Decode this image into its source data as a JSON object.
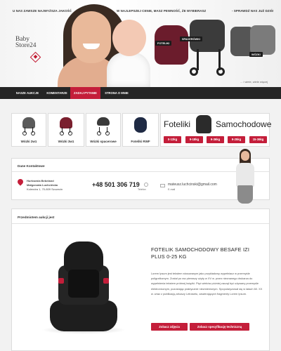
{
  "header": {
    "taglines": [
      "U NAS ZAWSZE NAJWYŻSZA JAKOŚĆ",
      "W NAJLEPSZEJ CENIE, MASZ PEWNOŚĆ, ŻE WYBIERASZ",
      "- SPRAWDŹ NAS JUŻ DZIŚ!"
    ],
    "logo_line1": "Baby",
    "logo_line2": "Store24",
    "badges": {
      "fotelik": "FOTELIKI",
      "spacerowki": "SPACERÓWKI",
      "wozki": "WÓZKI"
    },
    "more_text": "... i wiele, wiele więcej"
  },
  "nav": {
    "items": [
      {
        "label": "NASZE AUKCJE"
      },
      {
        "label": "KOMENTARZE"
      },
      {
        "label": "ZADAJ PYTANIE"
      },
      {
        "label": "STRONA O MNIE"
      }
    ],
    "active_index": 2
  },
  "categories": [
    {
      "label": "Wózki 2w1",
      "icon": "stroller-2in1-icon"
    },
    {
      "label": "Wózki 3w1",
      "icon": "stroller-3in1-icon"
    },
    {
      "label": "Wózki spacerowe",
      "icon": "buggy-icon"
    },
    {
      "label": "Foteliki RWF",
      "icon": "car-seat-rwf-icon"
    }
  ],
  "car_seats": {
    "title_left": "Foteliki",
    "title_right": "Samochodowe",
    "weights": [
      "0-13kg",
      "9-18kg",
      "9-36kg",
      "9-25kg",
      "15-36kg"
    ]
  },
  "contact": {
    "title": "Dane Kontaktowe",
    "company": "Hurtownia Bebeland",
    "person": "Małgorzata Luchcińska",
    "address": "Kolendra 1, 70-809 Szczecin",
    "phone": "+48 501 306 719",
    "phone_label": "Telefon",
    "email": "mateusz.luchcinski@gmail.com",
    "email_label": "E-mail"
  },
  "auction": {
    "title": "Przedmiotem aukcji jest",
    "product_name": "FOTELIK SAMOCHODOWY BESAFE IZI PLUS 0-25 KG",
    "description": "Lorem Ipsum jest tekstem stosowanym jako przykładowy wypełniacz w przemyśle poligraficznym. Został po raz pierwszy użyty w XV w. przez nieznanego drukarza do wypełnienia tekstem próbnej książki. Pięć wieków później zaczął być używany przemyśle elektronicznym, pozostając praktycznie niezmienionym. Spopularyzował się w latach 60. XX w. wraz z publikacją arkuszy Letrasetu, zawierających fragmenty Lorem Ipsum.",
    "btn_photos": "Zobacz zdjęcia",
    "btn_spec": "Zobacz specyfikację techniczną"
  },
  "colors": {
    "accent": "#c41e3a",
    "nav_bg": "#252525"
  }
}
